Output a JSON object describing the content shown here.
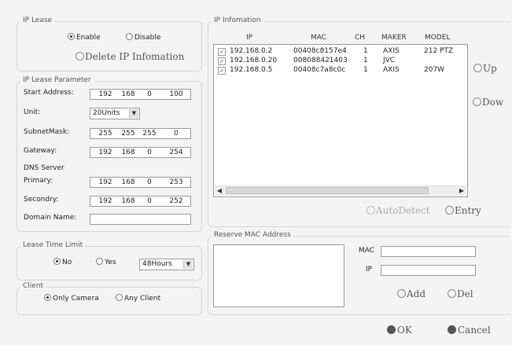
{
  "ip_lease": {
    "legend": "IP Lease",
    "enable_label": "Enable",
    "disable_label": "Disable",
    "delete_label": "Delete IP Infomation",
    "selected": "enable"
  },
  "params": {
    "legend": "IP Lease Parameter",
    "start_address": {
      "label": "Start Address:",
      "value": [
        "192",
        "168",
        "0",
        "100"
      ]
    },
    "unit": {
      "label": "Unit:",
      "value": "20Units"
    },
    "subnet_mask": {
      "label": "SubnetMask:",
      "value": [
        "255",
        "255",
        "255",
        "0"
      ]
    },
    "gateway": {
      "label": "Gateway:",
      "value": [
        "192",
        "168",
        "0",
        "254"
      ]
    },
    "dns_server_label": "DNS Server",
    "primary": {
      "label": "Primary:",
      "value": [
        "192",
        "168",
        "0",
        "253"
      ]
    },
    "secondary": {
      "label": "Secondry:",
      "value": [
        "192",
        "168",
        "0",
        "252"
      ]
    },
    "domain_name": {
      "label": "Domain Name:",
      "value": ""
    }
  },
  "lease_time": {
    "legend": "Lease Time Limit",
    "no_label": "No",
    "yes_label": "Yes",
    "selected": "no",
    "duration": "48Hours"
  },
  "client": {
    "legend": "Client",
    "only_camera_label": "Only Camera",
    "any_client_label": "Any Client",
    "selected": "only_camera"
  },
  "ip_info": {
    "legend": "IP Infomation",
    "columns": [
      "IP",
      "MAC",
      "CH",
      "MAKER",
      "MODEL"
    ],
    "rows": [
      {
        "ip": "192.168.0.2",
        "mac": "00408c8157e4",
        "ch": "1",
        "maker": "AXIS",
        "model": "212 PTZ",
        "checked": true
      },
      {
        "ip": "192.168.0.20",
        "mac": "008088421403",
        "ch": "1",
        "maker": "JVC",
        "model": "",
        "checked": true
      },
      {
        "ip": "192.168.0.5",
        "mac": "00408c7a8c0c",
        "ch": "1",
        "maker": "AXIS",
        "model": "207W",
        "checked": true
      }
    ],
    "up_label": "Up",
    "down_label": "Dow",
    "auto_detect_label": "AutoDetect",
    "entry_label": "Entry"
  },
  "reserve": {
    "legend": "Reserve MAC Address",
    "mac_label": "MAC",
    "mac_value": "",
    "ip_label": "IP",
    "ip_value": "",
    "add_label": "Add",
    "del_label": "Del"
  },
  "footer": {
    "ok_label": "OK",
    "cancel_label": "Cancel"
  }
}
